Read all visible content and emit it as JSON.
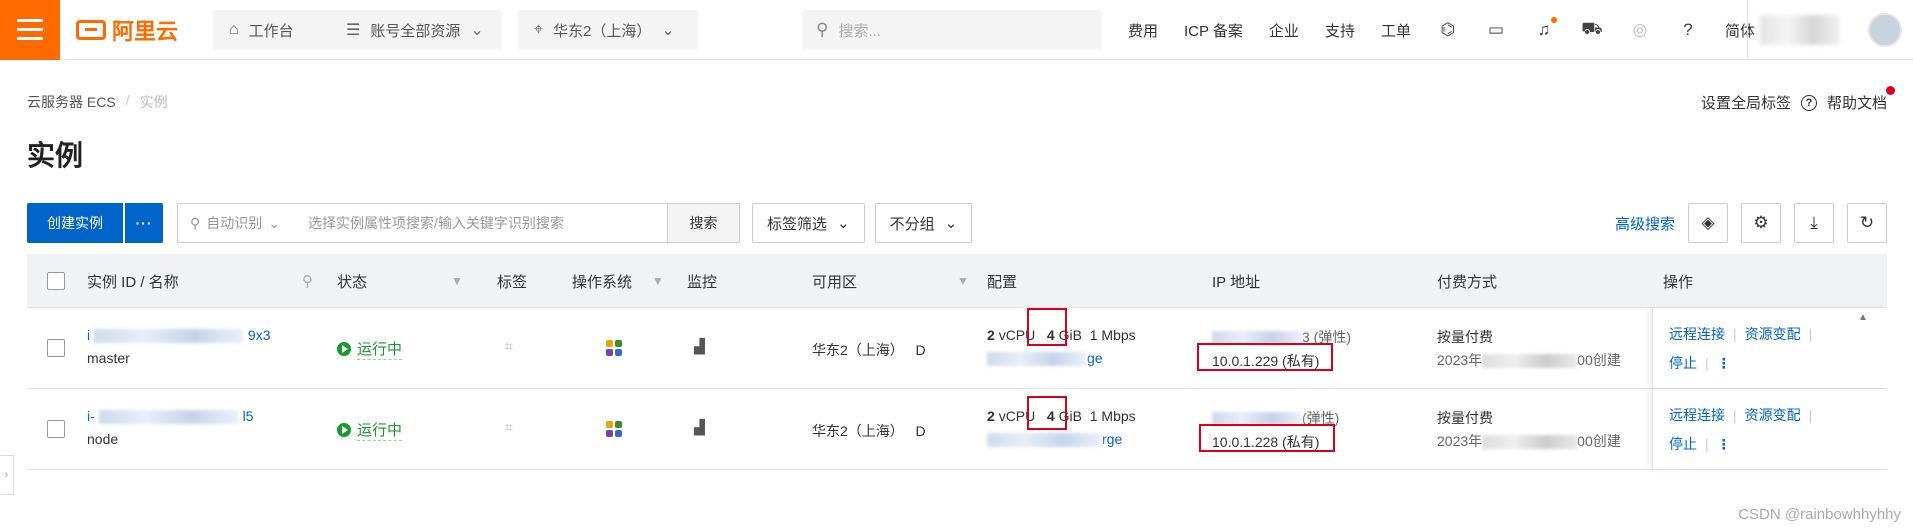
{
  "topbar": {
    "logo_text": "阿里云",
    "workbench": "工作台",
    "resources": "账号全部资源",
    "region": "华东2（上海）",
    "search_placeholder": "搜索...",
    "links": [
      "费用",
      "ICP 备案",
      "企业",
      "支持",
      "工单"
    ],
    "lang": "简体",
    "user_partial": "...anZe..."
  },
  "breadcrumb": {
    "root": "云服务器 ECS",
    "sep": "/",
    "current": "实例"
  },
  "header_right": {
    "tag_setting": "设置全局标签",
    "help": "帮助文档"
  },
  "page_title": "实例",
  "toolbar": {
    "create": "创建实例",
    "more": "···",
    "search_prefix": "自动识别",
    "search_placeholder": "选择实例属性项搜索/输入关键字识别搜索",
    "search_btn": "搜索",
    "tag_filter": "标签筛选",
    "group": "不分组",
    "advanced": "高级搜索"
  },
  "columns": {
    "id": "实例 ID / 名称",
    "status": "状态",
    "tag": "标签",
    "os": "操作系统",
    "monitor": "监控",
    "zone": "可用区",
    "config": "配置",
    "ip": "IP 地址",
    "billing": "付费方式",
    "ops": "操作"
  },
  "rows": [
    {
      "id_prefix": "i",
      "id_suffix": "9x3",
      "name": "master",
      "status": "运行中",
      "zone": "华东2（上海）",
      "zone_letter": "D",
      "cpu_num": "2",
      "cpu_unit": "vCPU",
      "mem_num": "4",
      "mem_unit": "GiB",
      "bw": "1 Mbps",
      "spec_suffix": "ge",
      "ip_public_suffix": "3 (弹性)",
      "ip_private": "10.0.1.229 (私有)",
      "billing": "按量付费",
      "created_prefix": "2023年",
      "created_suffix": "00创建",
      "op1": "远程连接",
      "op2": "资源变配",
      "op3": "停止"
    },
    {
      "id_prefix": "i-",
      "id_suffix": "l5",
      "name": "node",
      "status": "运行中",
      "zone": "华东2（上海）",
      "zone_letter": "D",
      "cpu_num": "2",
      "cpu_unit": "vCPU",
      "mem_num": "4",
      "mem_unit": "GiB",
      "bw": "1 Mbps",
      "spec_suffix": "rge",
      "ip_public_suffix": "(弹性)",
      "ip_private": "10.0.1.228 (私有)",
      "billing": "按量付费",
      "created_prefix": "2023年",
      "created_suffix": "00创建",
      "op1": "远程连接",
      "op2": "资源变配",
      "op3": "停止"
    }
  ],
  "watermark": "CSDN @rainbowhhyhhy",
  "colors": {
    "brand": "#ff6a00",
    "primary": "#0064c8",
    "running": "#1a9a2c",
    "highlight": "#d9001b"
  }
}
